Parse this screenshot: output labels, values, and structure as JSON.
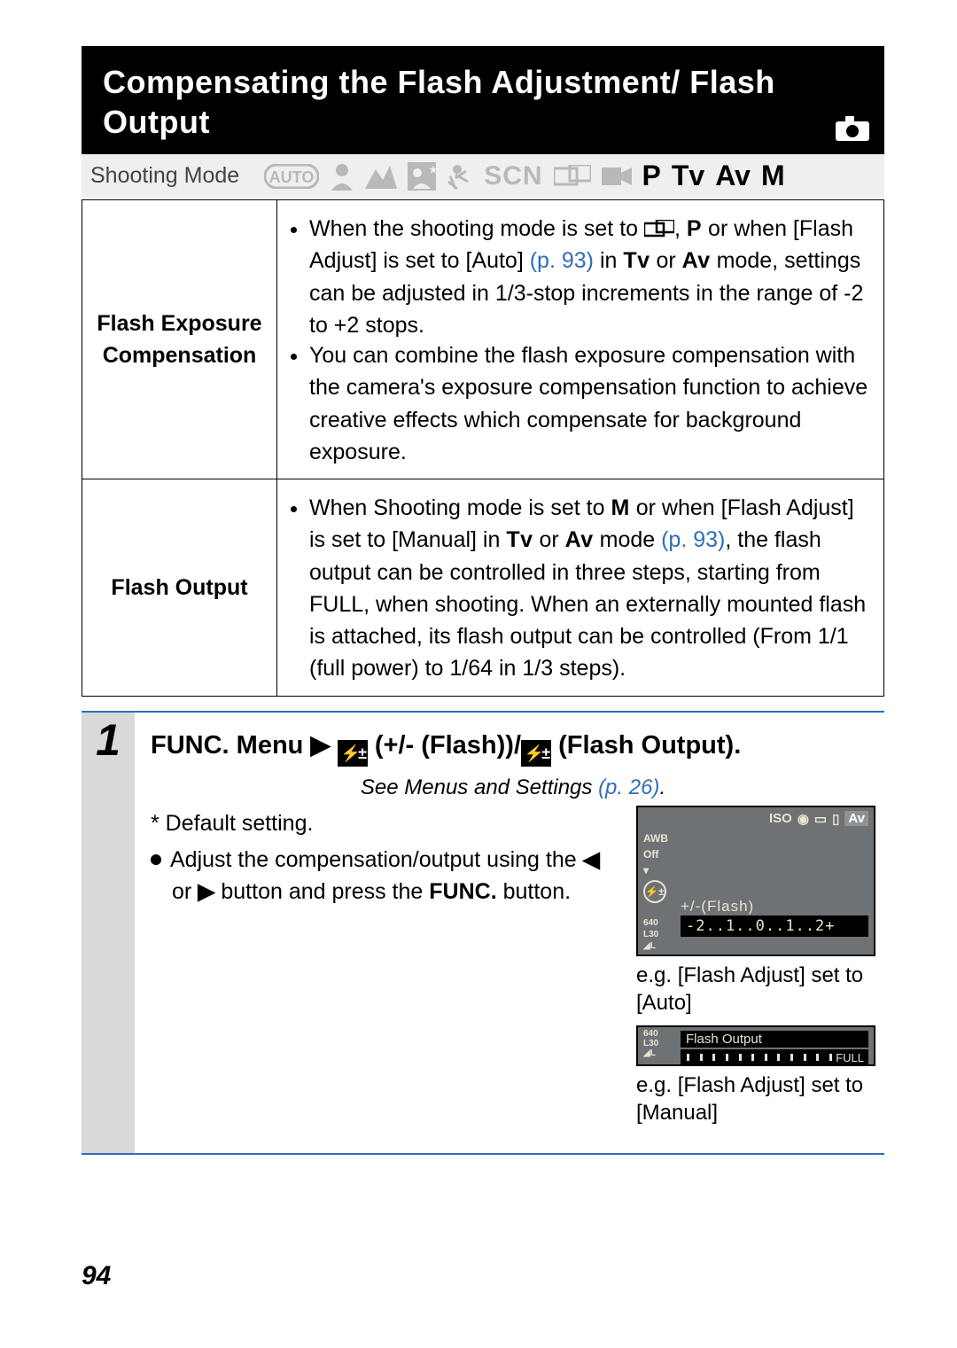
{
  "title": "Compensating the Flash Adjustment/ Flash Output",
  "mode_row": {
    "label": "Shooting Mode",
    "items": {
      "auto": "AUTO",
      "scn": "SCN",
      "p": "P",
      "tv": "Tv",
      "av": "Av",
      "m": "M"
    }
  },
  "table": {
    "r1h": "Flash Exposure Compensation",
    "r1_li1_a": "When the shooting mode is set to ",
    "r1_li1_b": ", ",
    "r1_li1_p": "P",
    "r1_li1_c": " or when [Flash Adjust] is set to [Auto] ",
    "r1_li1_pref": "(p. 93)",
    "r1_li1_d": " in ",
    "r1_li1_tv": "Tv",
    "r1_li1_e": " or ",
    "r1_li1_av": "Av",
    "r1_li1_f": " mode, settings can be adjusted in 1/3-stop increments in the range of -2 to +2 stops.",
    "r1_li2": "You can combine the flash exposure compensation with the camera's exposure compensation function to achieve creative effects which compensate for background exposure.",
    "r2h": "Flash Output",
    "r2_li1_a": "When Shooting mode is set to ",
    "r2_li1_m": "M",
    "r2_li1_b": " or when [Flash Adjust] is set to [Manual] in ",
    "r2_li1_tv": "Tv",
    "r2_li1_c": " or ",
    "r2_li1_av": "Av",
    "r2_li1_d": " mode ",
    "r2_li1_pref": "(p. 93)",
    "r2_li1_e": ", the flash output can be controlled in three steps, starting from FULL, when shooting. When an externally mounted flash is attached, its flash output can be controlled (From 1/1 (full power) to 1/64 in 1/3 steps)."
  },
  "step": {
    "num": "1",
    "heading_a": "FUNC.",
    "heading_b": " Menu ",
    "heading_c": " (+/- (Flash))/",
    "heading_d": " (Flash Output).",
    "sub_a": "See Menus and Settings ",
    "sub_pref": "(p. 26)",
    "sub_b": ".",
    "default": "* Default setting.",
    "bullet_a": "Adjust the compensation/output using the ",
    "bullet_b": " or ",
    "bullet_c": " button and press the ",
    "bullet_func": "FUNC.",
    "bullet_d": " button."
  },
  "sshot": {
    "top": {
      "iso": "ISO",
      "av": "Av"
    },
    "left": {
      "awb": "AWB",
      "off": "Off",
      "sel": "⚡±",
      "s640": "640",
      "l30": "L30",
      "bl": "◢L"
    },
    "bar_label": "+/-(Flash)",
    "bar_scale": "-2..1..0..1..2+"
  },
  "caption1": "e.g. [Flash Adjust] set to [Auto]",
  "sshot2": {
    "left": {
      "s640": "640",
      "l30": "L30",
      "bl": "◢L"
    },
    "bar_label": "Flash Output",
    "full": "FULL"
  },
  "caption2": "e.g. [Flash Adjust] set to [Manual]",
  "page_number": "94"
}
